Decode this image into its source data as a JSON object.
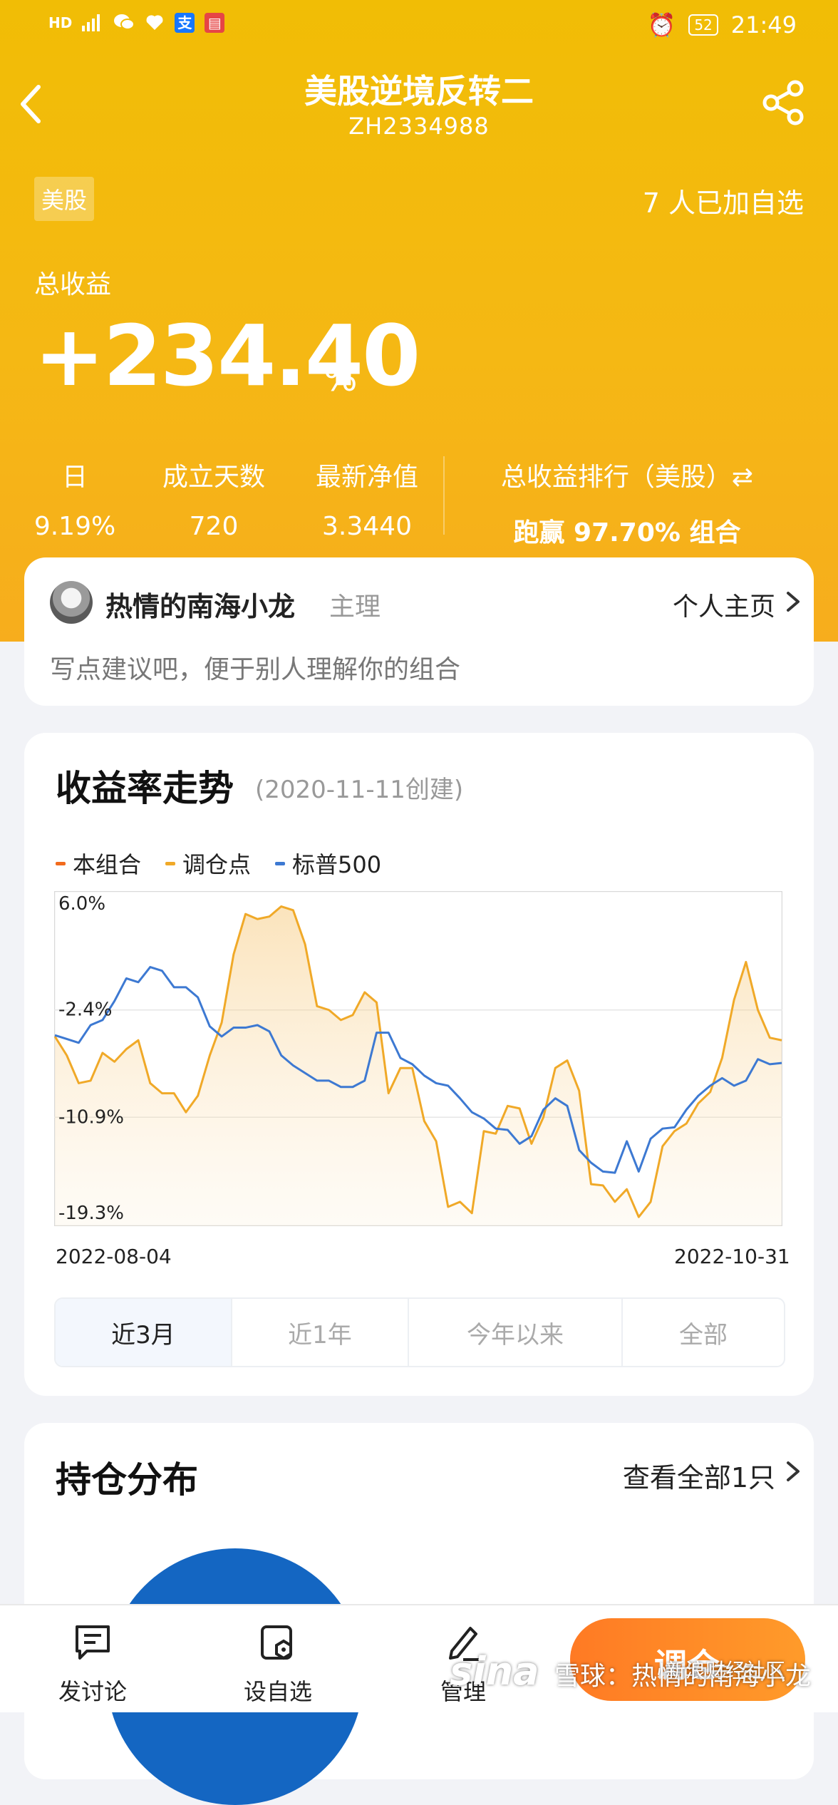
{
  "status_bar": {
    "left_icons": [
      "HD",
      "5G",
      "wechat-icon",
      "heart-icon",
      "支",
      "book-icon"
    ],
    "battery": "52",
    "time": "21:49"
  },
  "header": {
    "title": "美股逆境反转二",
    "code": "ZH2334988"
  },
  "summary": {
    "market_tag": "美股",
    "followers": "7 人已加自选",
    "total_return_label": "总收益",
    "total_return_value": "+234.40",
    "total_return_unit": "%",
    "stats": [
      {
        "label": "日",
        "value": "9.19%"
      },
      {
        "label": "成立天数",
        "value": "720"
      },
      {
        "label": "最新净值",
        "value": "3.3440"
      },
      {
        "label": "总收益排行（美股）⇄",
        "value": "跑赢 97.70% 组合"
      }
    ]
  },
  "manager": {
    "name": "热情的南海小龙",
    "role": "主理",
    "home_link": "个人主页",
    "description": "写点建议吧，便于别人理解你的组合"
  },
  "chart_section": {
    "title": "收益率走势",
    "subtitle": "(2020-11-11创建)",
    "legend": [
      "本组合",
      "调仓点",
      "标普500"
    ],
    "tabs": [
      "近3月",
      "近1年",
      "今年以来",
      "全部"
    ],
    "active_tab": "近3月",
    "colors": {
      "portfolio": "#f0a928",
      "rebalance": "#f0a928",
      "sp500": "#3d79d2",
      "portfolio_legend": "#f26b1d"
    }
  },
  "chart_data": {
    "type": "area",
    "title": "收益率走势",
    "ylim": [
      -19.3,
      6.0
    ],
    "y_ticks": [
      "6.0%",
      "-2.4%",
      "-10.9%",
      "-19.3%"
    ],
    "y_tick_values": [
      6.0,
      -2.4,
      -10.9,
      -19.3
    ],
    "x_start": "2022-08-04",
    "x_end": "2022-10-31",
    "x": [
      "2022-08-04",
      "2022-08-05",
      "2022-08-08",
      "2022-08-09",
      "2022-08-10",
      "2022-08-11",
      "2022-08-12",
      "2022-08-15",
      "2022-08-16",
      "2022-08-17",
      "2022-08-18",
      "2022-08-19",
      "2022-08-22",
      "2022-08-23",
      "2022-08-24",
      "2022-08-25",
      "2022-08-26",
      "2022-08-29",
      "2022-08-30",
      "2022-08-31",
      "2022-09-01",
      "2022-09-02",
      "2022-09-06",
      "2022-09-07",
      "2022-09-08",
      "2022-09-09",
      "2022-09-12",
      "2022-09-13",
      "2022-09-14",
      "2022-09-15",
      "2022-09-16",
      "2022-09-19",
      "2022-09-20",
      "2022-09-21",
      "2022-09-22",
      "2022-09-23",
      "2022-09-26",
      "2022-09-27",
      "2022-09-28",
      "2022-09-29",
      "2022-09-30",
      "2022-10-03",
      "2022-10-04",
      "2022-10-05",
      "2022-10-06",
      "2022-10-07",
      "2022-10-10",
      "2022-10-11",
      "2022-10-12",
      "2022-10-13",
      "2022-10-14",
      "2022-10-17",
      "2022-10-18",
      "2022-10-19",
      "2022-10-20",
      "2022-10-21",
      "2022-10-24",
      "2022-10-25",
      "2022-10-26",
      "2022-10-27",
      "2022-10-28",
      "2022-10-31"
    ],
    "series": [
      {
        "name": "本组合",
        "values": [
          -4.5,
          -6.0,
          -8.2,
          -8.0,
          -5.8,
          -6.5,
          -5.5,
          -4.8,
          -8.2,
          -9.0,
          -9.0,
          -10.5,
          -9.2,
          -6.0,
          -3.4,
          2.0,
          5.2,
          4.8,
          5.0,
          5.8,
          5.5,
          2.8,
          -2.1,
          -2.4,
          -3.2,
          -2.8,
          -1.0,
          -1.8,
          -9.0,
          -7.0,
          -7.0,
          -11.2,
          -12.8,
          -18.0,
          -17.6,
          -18.5,
          -12.0,
          -12.2,
          -10.0,
          -10.2,
          -13.0,
          -10.9,
          -7.0,
          -6.4,
          -8.8,
          -16.2,
          -16.3,
          -17.6,
          -16.6,
          -18.8,
          -17.6,
          -13.2,
          -12.0,
          -11.4,
          -9.8,
          -8.9,
          -6.2,
          -1.6,
          1.4,
          -2.4,
          -4.6,
          -4.8
        ]
      },
      {
        "name": "标普500",
        "values": [
          -4.4,
          -4.7,
          -5.0,
          -3.6,
          -3.2,
          -1.7,
          0.1,
          -0.2,
          1.0,
          0.7,
          -0.6,
          -0.6,
          -1.4,
          -3.7,
          -4.5,
          -3.8,
          -3.8,
          -3.6,
          -4.1,
          -6.0,
          -6.8,
          -7.4,
          -8.0,
          -8.0,
          -8.5,
          -8.5,
          -8.0,
          -4.2,
          -4.2,
          -6.2,
          -6.7,
          -7.6,
          -8.2,
          -8.4,
          -9.4,
          -10.5,
          -11.0,
          -11.8,
          -11.9,
          -13.0,
          -12.4,
          -10.3,
          -9.4,
          -10.0,
          -13.5,
          -14.5,
          -15.2,
          -15.3,
          -12.8,
          -15.2,
          -12.6,
          -11.8,
          -11.7,
          -10.3,
          -9.2,
          -8.4,
          -7.8,
          -8.4,
          -8.0,
          -6.3,
          -6.7,
          -6.6
        ]
      }
    ]
  },
  "holdings": {
    "title": "持仓分布",
    "link": "查看全部1只"
  },
  "bottom_bar": {
    "buttons": [
      "发讨论",
      "设自选",
      "管理"
    ],
    "primary": "调仓"
  },
  "watermark": {
    "logo": "sina",
    "line1": "新浪财经社区",
    "line2": "雪球：热情的南海小龙"
  }
}
